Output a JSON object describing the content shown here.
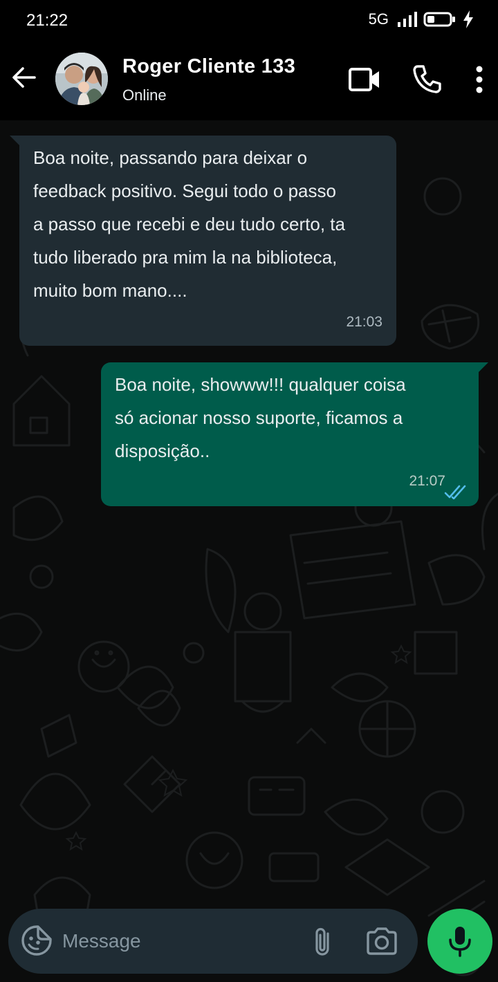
{
  "status_bar": {
    "time": "21:22",
    "network": "5G",
    "icons": [
      "signal-icon",
      "battery-icon",
      "charging-bolt-icon"
    ]
  },
  "header": {
    "contact_name": "Roger Cliente 133",
    "contact_status": "Online",
    "icons": [
      "back-arrow-icon",
      "video-call-icon",
      "phone-icon",
      "more-options-icon"
    ]
  },
  "messages": [
    {
      "direction": "incoming",
      "text": "Boa noite, passando para deixar o\nfeedback positivo. Segui todo o passo\na passo que recebi e deu tudo certo, ta\ntudo liberado pra mim la na biblioteca,\nmuito bom mano....",
      "time": "21:03"
    },
    {
      "direction": "outgoing",
      "text": "Boa noite, showww!!! qualquer coisa\nsó acionar nosso suporte, ficamos a\ndisposição..",
      "time": "21:07",
      "status_icon": "double-check-read-icon"
    }
  ],
  "composer": {
    "placeholder": "Message",
    "value": "",
    "icons": [
      "emoji-sticker-icon",
      "paperclip-icon",
      "camera-icon",
      "microphone-icon"
    ]
  },
  "colors": {
    "header_bg": "#000000",
    "chat_bg": "#0b0c0c",
    "incoming_bubble": "#202c33",
    "outgoing_bubble": "#005c4b",
    "read_ticks": "#53bdeb",
    "mic_button": "#21c063",
    "composer_bg": "#1f2c34"
  }
}
